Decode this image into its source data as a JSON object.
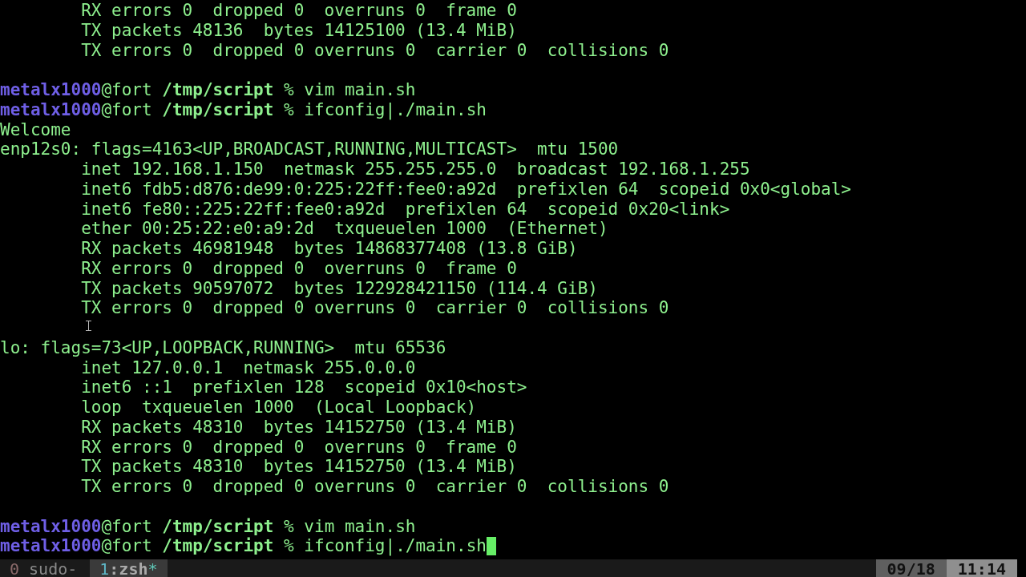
{
  "terminal": {
    "lines": [
      {
        "kind": "output",
        "text": "        RX errors 0  dropped 0  overruns 0  frame 0"
      },
      {
        "kind": "output",
        "text": "        TX packets 48136  bytes 14125100 (13.4 MiB)"
      },
      {
        "kind": "output",
        "text": "        TX errors 0  dropped 0 overruns 0  carrier 0  collisions 0"
      },
      {
        "kind": "blank"
      },
      {
        "kind": "prompt",
        "user": "metalx1000",
        "host": "@fort",
        "path": "/tmp/script",
        "symbol": "%",
        "command": "vim main.sh",
        "cursor": false
      },
      {
        "kind": "prompt",
        "user": "metalx1000",
        "host": "@fort",
        "path": "/tmp/script",
        "symbol": "%",
        "command": "ifconfig|./main.sh",
        "cursor": false
      },
      {
        "kind": "output",
        "text": "Welcome"
      },
      {
        "kind": "output",
        "text": "enp12s0: flags=4163<UP,BROADCAST,RUNNING,MULTICAST>  mtu 1500"
      },
      {
        "kind": "output",
        "text": "        inet 192.168.1.150  netmask 255.255.255.0  broadcast 192.168.1.255"
      },
      {
        "kind": "output",
        "text": "        inet6 fdb5:d876:de99:0:225:22ff:fee0:a92d  prefixlen 64  scopeid 0x0<global>"
      },
      {
        "kind": "output",
        "text": "        inet6 fe80::225:22ff:fee0:a92d  prefixlen 64  scopeid 0x20<link>"
      },
      {
        "kind": "output",
        "text": "        ether 00:25:22:e0:a9:2d  txqueuelen 1000  (Ethernet)"
      },
      {
        "kind": "output",
        "text": "        RX packets 46981948  bytes 14868377408 (13.8 GiB)"
      },
      {
        "kind": "output",
        "text": "        RX errors 0  dropped 0  overruns 0  frame 0"
      },
      {
        "kind": "output",
        "text": "        TX packets 90597072  bytes 122928421150 (114.4 GiB)"
      },
      {
        "kind": "output",
        "text": "        TX errors 0  dropped 0 overruns 0  carrier 0  collisions 0"
      },
      {
        "kind": "blank"
      },
      {
        "kind": "output",
        "text": "lo: flags=73<UP,LOOPBACK,RUNNING>  mtu 65536"
      },
      {
        "kind": "output",
        "text": "        inet 127.0.0.1  netmask 255.0.0.0"
      },
      {
        "kind": "output",
        "text": "        inet6 ::1  prefixlen 128  scopeid 0x10<host>"
      },
      {
        "kind": "output",
        "text": "        loop  txqueuelen 1000  (Local Loopback)"
      },
      {
        "kind": "output",
        "text": "        RX packets 48310  bytes 14152750 (13.4 MiB)"
      },
      {
        "kind": "output",
        "text": "        RX errors 0  dropped 0  overruns 0  frame 0"
      },
      {
        "kind": "output",
        "text": "        TX packets 48310  bytes 14152750 (13.4 MiB)"
      },
      {
        "kind": "output",
        "text": "        TX errors 0  dropped 0 overruns 0  carrier 0  collisions 0"
      },
      {
        "kind": "blank"
      },
      {
        "kind": "prompt",
        "user": "metalx1000",
        "host": "@fort",
        "path": "/tmp/script",
        "symbol": "%",
        "command": "vim main.sh",
        "cursor": false
      },
      {
        "kind": "prompt",
        "user": "metalx1000",
        "host": "@fort",
        "path": "/tmp/script",
        "symbol": "%",
        "command": "ifconfig|./main.sh",
        "cursor": true
      }
    ]
  },
  "status_bar": {
    "windows": [
      {
        "index": "0",
        "name": "sudo",
        "flag": "-",
        "selected": false
      },
      {
        "index": "1",
        "separator": ":",
        "name": "zsh",
        "flag": "*",
        "selected": true
      }
    ],
    "date": "09/18",
    "time": "11:14"
  }
}
